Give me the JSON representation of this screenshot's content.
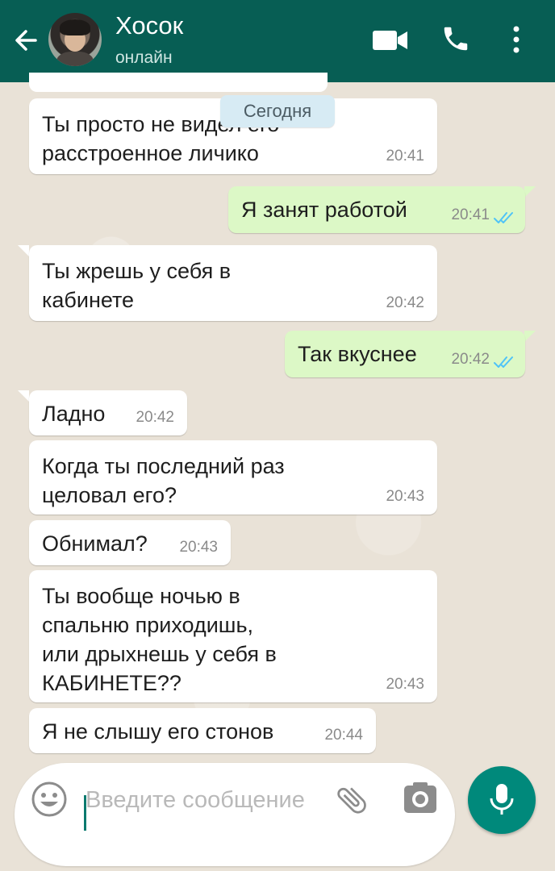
{
  "header": {
    "contact_name": "Хосок",
    "status": "онлайн"
  },
  "date_chip": "Сегодня",
  "messages": [
    {
      "dir": "in",
      "text": "Ты просто не видел его\nрасстроенное личико",
      "time": "20:41"
    },
    {
      "dir": "out",
      "text": "Я занят работой",
      "time": "20:41",
      "read": true
    },
    {
      "dir": "in",
      "text": "Ты жрешь у себя в\nкабинете",
      "time": "20:42"
    },
    {
      "dir": "out",
      "text": "Так вкуснее",
      "time": "20:42",
      "read": true
    },
    {
      "dir": "in",
      "text": "Ладно",
      "time": "20:42"
    },
    {
      "dir": "in",
      "text": "Когда ты последний раз\nцеловал его?",
      "time": "20:43"
    },
    {
      "dir": "in",
      "text": "Обнимал?",
      "time": "20:43"
    },
    {
      "dir": "in",
      "text": "Ты вообще ночью в\nспальню приходишь,\nили дрыхнешь у себя в\nКАБИНЕТЕ??",
      "time": "20:43"
    },
    {
      "dir": "in",
      "text": "Я не слышу его стонов",
      "time": "20:44"
    }
  ],
  "input": {
    "placeholder": "Введите сообщение"
  },
  "colors": {
    "header": "#075e54",
    "outgoing_bubble": "#dcf8c6",
    "incoming_bubble": "#ffffff",
    "read_ticks": "#4fc3f7",
    "mic_button": "#00897b"
  },
  "icons": [
    "back-arrow-icon",
    "video-call-icon",
    "phone-icon",
    "more-vert-icon",
    "emoji-icon",
    "paperclip-icon",
    "camera-icon",
    "mic-icon",
    "double-check-icon"
  ]
}
